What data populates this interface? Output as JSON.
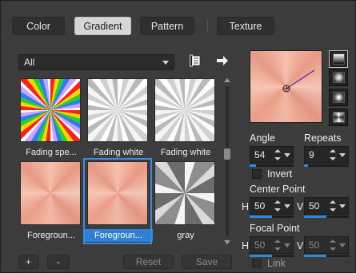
{
  "tabs": [
    {
      "label": "Color",
      "active": false
    },
    {
      "label": "Gradient",
      "active": true
    },
    {
      "label": "Pattern",
      "active": false
    },
    {
      "label": "Texture",
      "active": false
    }
  ],
  "category": {
    "selected": "All"
  },
  "icons": {
    "library": "library-icon",
    "export": "arrow-right-icon"
  },
  "gallery": [
    {
      "caption": "Fading spe...",
      "swatch": "rainbow"
    },
    {
      "caption": "Fading white",
      "swatch": "white"
    },
    {
      "caption": "Fading white",
      "swatch": "white"
    },
    {
      "caption": "Foregroun...",
      "swatch": "peach"
    },
    {
      "caption": "Foregroun...",
      "swatch": "peach",
      "selected": true
    },
    {
      "caption": "gray",
      "swatch": "gray"
    }
  ],
  "bottom_buttons": {
    "add": "+",
    "remove": "-",
    "reset": "Reset",
    "save": "Save"
  },
  "angle": {
    "label": "Angle",
    "value": "54",
    "fraction": 0.15
  },
  "repeats": {
    "label": "Repeats",
    "value": "9",
    "fraction": 0.09
  },
  "invert": {
    "label": "Invert",
    "checked": false
  },
  "center_point": {
    "label": "Center Point",
    "h_label": "H",
    "h_value": "50",
    "v_label": "V",
    "v_value": "50",
    "h_fraction": 0.5,
    "v_fraction": 0.5
  },
  "focal_point": {
    "label": "Focal Point",
    "h_label": "H",
    "h_value": "50",
    "v_label": "V",
    "v_value": "50",
    "h_fraction": 0.5,
    "v_fraction": 0.5,
    "enabled": false
  },
  "link": {
    "label": "Link",
    "checked": false
  },
  "colors": {
    "accent": "#2f86e0",
    "selection": "#3a8de0"
  }
}
